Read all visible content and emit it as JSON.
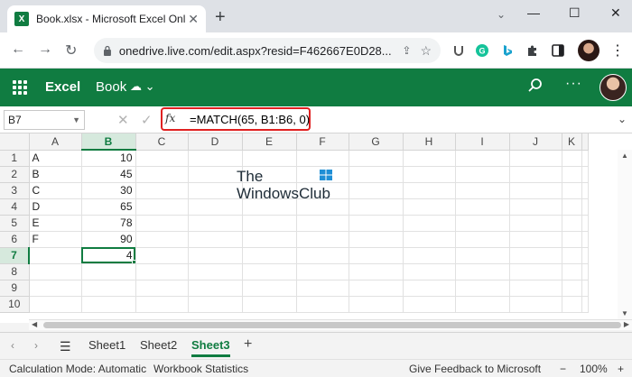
{
  "browser": {
    "tab_title": "Book.xlsx - Microsoft Excel Online",
    "tab_icon": "X",
    "close_label": "✕",
    "new_tab_label": "+",
    "url": "onedrive.live.com/edit.aspx?resid=F462667E0D28..."
  },
  "excel_header": {
    "app_name": "Excel",
    "book_name": "Book",
    "more_label": "···"
  },
  "formula_bar": {
    "name_box": "B7",
    "fx_label": "fx",
    "formula": "=MATCH(65, B1:B6, 0)"
  },
  "grid": {
    "columns": [
      "A",
      "B",
      "C",
      "D",
      "E",
      "F",
      "G",
      "H",
      "I",
      "J",
      "K"
    ],
    "selected_column": "B",
    "selected_row": "7",
    "rows": [
      {
        "n": "1",
        "a": "A",
        "b": "10"
      },
      {
        "n": "2",
        "a": "B",
        "b": "45"
      },
      {
        "n": "3",
        "a": "C",
        "b": "30"
      },
      {
        "n": "4",
        "a": "D",
        "b": "65"
      },
      {
        "n": "5",
        "a": "E",
        "b": "78"
      },
      {
        "n": "6",
        "a": "F",
        "b": "90"
      },
      {
        "n": "7",
        "a": "",
        "b": "4"
      },
      {
        "n": "8",
        "a": "",
        "b": ""
      },
      {
        "n": "9",
        "a": "",
        "b": ""
      },
      {
        "n": "10",
        "a": "",
        "b": ""
      }
    ]
  },
  "watermark": {
    "line1": "The",
    "line2": "WindowsClub"
  },
  "sheets": {
    "tabs": [
      "Sheet1",
      "Sheet2",
      "Sheet3"
    ],
    "active": "Sheet3",
    "add_label": "+"
  },
  "status": {
    "calc_mode": "Calculation Mode: Automatic",
    "workbook_stats": "Workbook Statistics",
    "feedback": "Give Feedback to Microsoft",
    "zoom": "100%",
    "zoom_minus": "−",
    "zoom_plus": "+"
  },
  "colors": {
    "excel_green": "#107c41",
    "highlight_red": "#e02020"
  }
}
